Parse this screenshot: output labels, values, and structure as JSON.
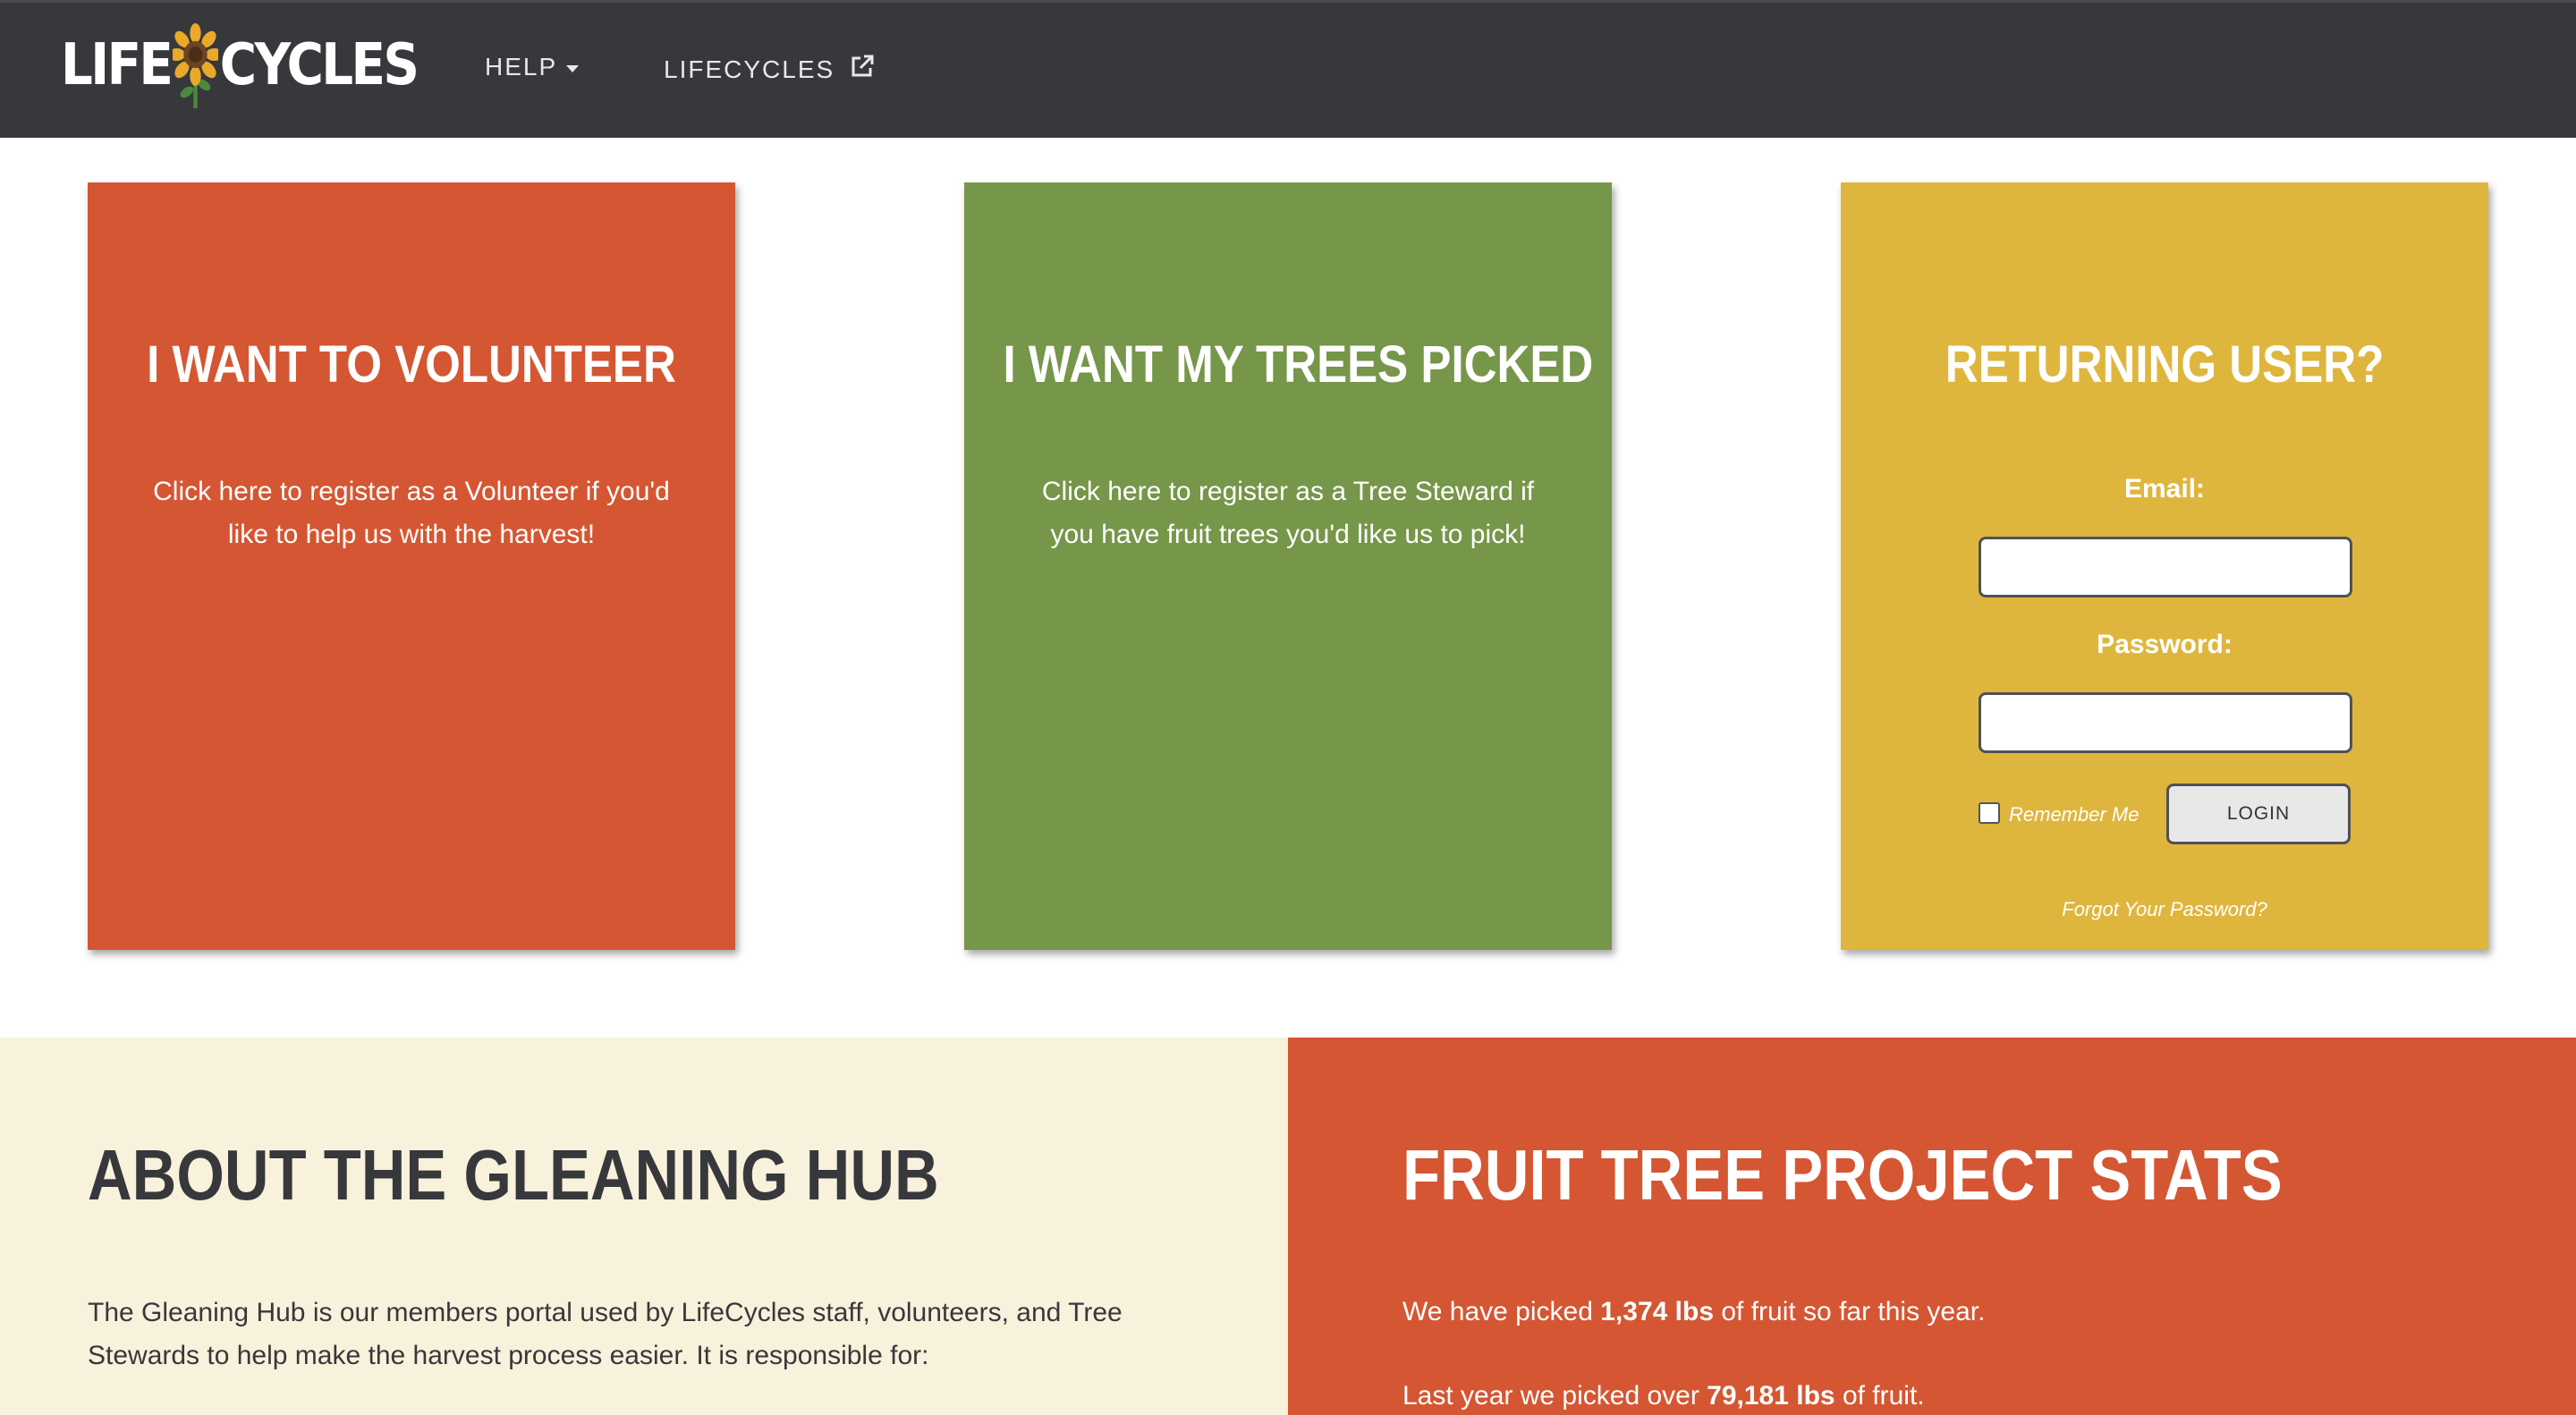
{
  "navbar": {
    "logo_left": "LIFE",
    "logo_right": "CYCLES",
    "help_label": "HELP",
    "lifecycles_label": "LIFECYCLES",
    "icons": [
      "sunflower-icon",
      "caret-down-icon",
      "external-link-icon"
    ]
  },
  "cards": {
    "volunteer": {
      "title": "I WANT TO VOLUNTEER",
      "text": "Click here to register as a Volunteer if you'd like to help us with the harvest!"
    },
    "trees": {
      "title": "I WANT MY TREES PICKED",
      "text": "Click here to register as a Tree Steward if you have fruit trees you'd like us to pick!"
    },
    "login": {
      "title": "RETURNING USER?",
      "email_label": "Email:",
      "email_value": "",
      "password_label": "Password:",
      "password_value": "",
      "remember_label": "Remember Me",
      "remember_checked": false,
      "login_button": "LOGIN",
      "forgot_link": "Forgot Your Password?"
    }
  },
  "about": {
    "title": "ABOUT THE GLEANING HUB",
    "text": "The Gleaning Hub is our members portal used by LifeCycles staff, volunteers, and Tree Stewards to help make the harvest process easier. It is responsible for:"
  },
  "stats": {
    "title": "FRUIT TREE PROJECT STATS",
    "line1_prefix": "We have picked ",
    "line1_value": "1,374 lbs",
    "line1_suffix": " of fruit so far this year.",
    "line2_prefix": "Last year we picked over ",
    "line2_value": "79,181 lbs",
    "line2_suffix": " of fruit."
  },
  "colors": {
    "navbar": "#37383c",
    "volunteer": "#d55632",
    "trees": "#76964a",
    "login": "#dfb63d",
    "about_bg": "#f8f1db",
    "stats_bg": "#d55632"
  }
}
